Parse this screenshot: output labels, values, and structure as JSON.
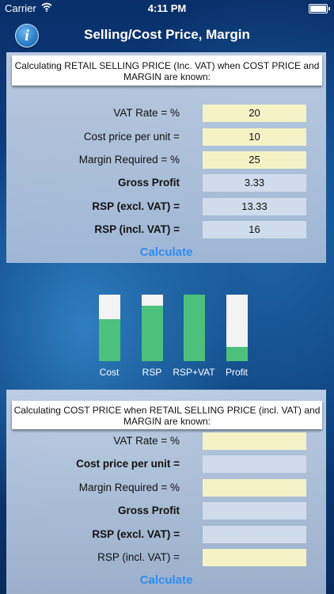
{
  "status_bar": {
    "carrier": "Carrier",
    "time": "4:11 PM"
  },
  "nav": {
    "title": "Selling/Cost Price, Margin",
    "info_icon": "info-icon",
    "info_glyph": "i"
  },
  "section1": {
    "header": "Calculating RETAIL SELLING PRICE (Inc. VAT) when COST PRICE and MARGIN are known:",
    "rows": [
      {
        "label": "VAT Rate = %",
        "value": "20"
      },
      {
        "label": "Cost price per unit =",
        "value": "10"
      },
      {
        "label": "Margin Required = %",
        "value": "25"
      },
      {
        "label": "Gross Profit",
        "value": "3.33"
      },
      {
        "label": "RSP (excl. VAT) =",
        "value": "13.33"
      },
      {
        "label": "RSP (incl. VAT) =",
        "value": "16"
      }
    ],
    "calculate": "Calculate"
  },
  "bars": {
    "fill_color": "#4cc17c",
    "items": [
      {
        "label": "Cost",
        "fraction": 0.625
      },
      {
        "label": "RSP",
        "fraction": 0.83
      },
      {
        "label": "RSP+VAT",
        "fraction": 1.0
      },
      {
        "label": "Profit",
        "fraction": 0.21
      }
    ]
  },
  "section2": {
    "header": "Calculating COST PRICE when RETAIL SELLING PRICE (incl. VAT) and MARGIN are known:",
    "rows": [
      {
        "label": "VAT Rate = %",
        "value": ""
      },
      {
        "label": "Cost price per unit =",
        "value": ""
      },
      {
        "label": "Margin Required = %",
        "value": ""
      },
      {
        "label": "Gross Profit",
        "value": ""
      },
      {
        "label": "RSP (excl. VAT) =",
        "value": ""
      },
      {
        "label": "RSP (incl. VAT) =",
        "value": ""
      }
    ],
    "calculate": "Calculate"
  },
  "colors": {
    "accent": "#2f8cf0",
    "input_bg": "#f5f3c6",
    "output_bg": "#d2ddec"
  }
}
